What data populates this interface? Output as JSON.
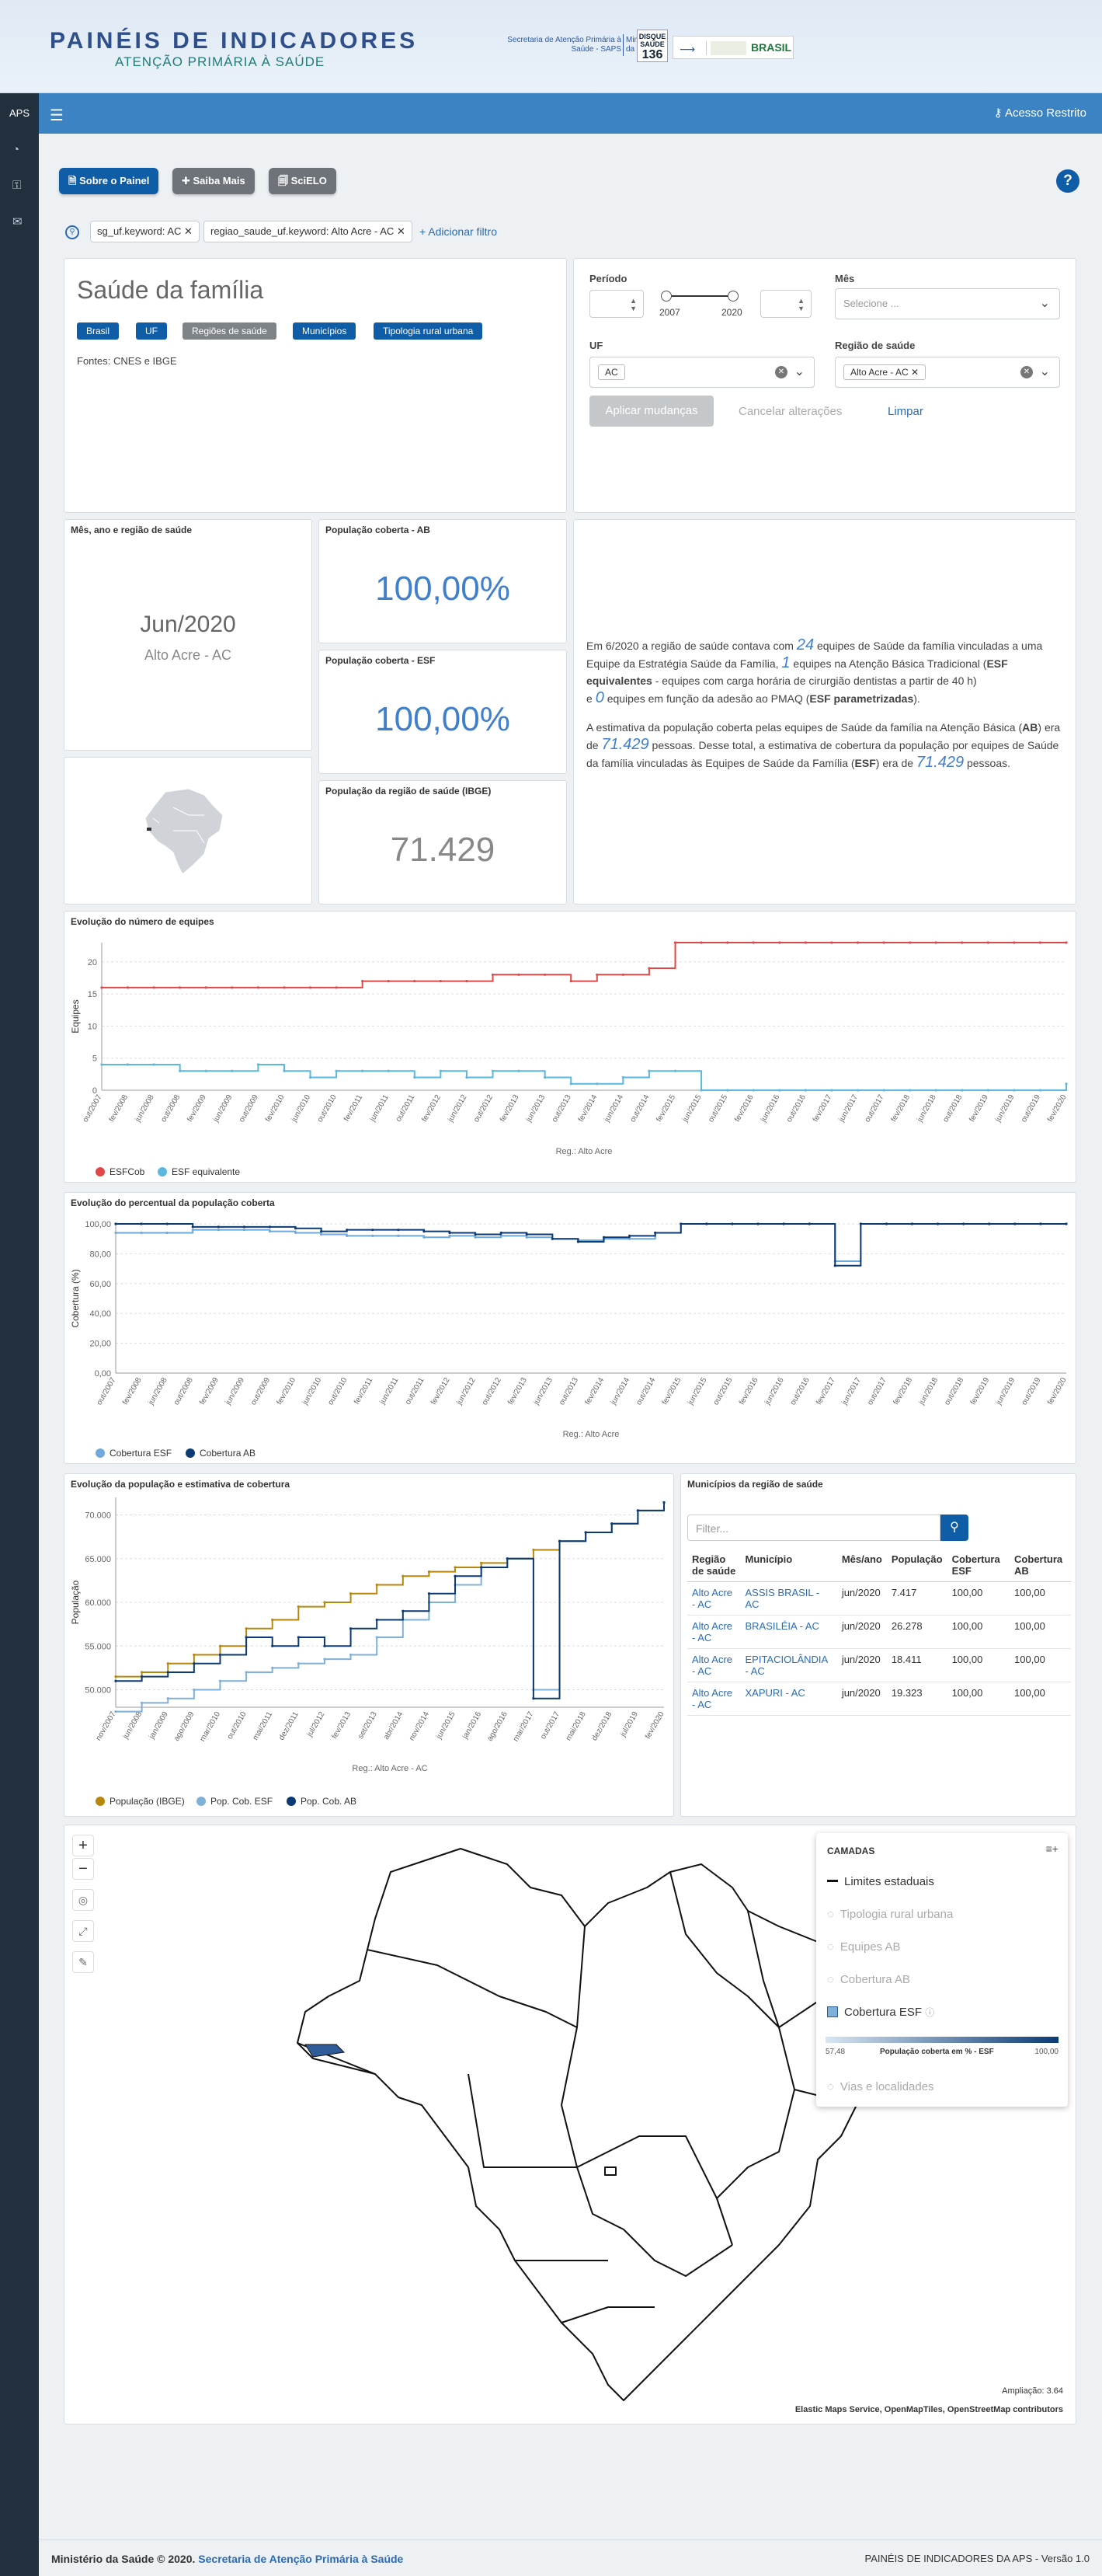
{
  "header": {
    "title": "PAINÉIS DE INDICADORES",
    "subtitle": "ATENÇÃO PRIMÁRIA À SAÚDE",
    "secretaria": "Secretaria de Atenção Primária à Saúde - SAPS",
    "ministerio": "Ministério da Saúde",
    "disque": "DISQUE SAÚDE",
    "disque_num": "136",
    "brasil": "BRASIL"
  },
  "topbar": {
    "aps": "APS",
    "login": "Acesso Restrito"
  },
  "toolbar": {
    "sobre": "Sobre o Painel",
    "saiba": "Saiba Mais",
    "scielo": "SciELO",
    "help": "?"
  },
  "filters": {
    "f1": "sg_uf.keyword: AC",
    "f2": "regiao_saude_uf.keyword: Alto Acre - AC",
    "add": "+ Adicionar filtro"
  },
  "panel": {
    "title": "Saúde da família",
    "tabs": [
      "Brasil",
      "UF",
      "Regiões de saúde",
      "Municípios",
      "Tipologia rural urbana"
    ],
    "fontes": "Fontes: CNES e IBGE"
  },
  "controls": {
    "periodo": "Período",
    "year_start": "2007",
    "year_end": "2020",
    "mes": "Mês",
    "mes_placeholder": "Selecione ...",
    "uf": "UF",
    "uf_value": "AC",
    "regiao": "Região de saúde",
    "regiao_value": "Alto Acre - AC",
    "apply": "Aplicar mudanças",
    "cancel": "Cancelar alterações",
    "clear": "Limpar"
  },
  "metrics": {
    "mes_title": "Mês, ano e região de saúde",
    "mes_value": "Jun/2020",
    "regiao_value": "Alto Acre - AC",
    "ab_title": "População coberta - AB",
    "ab_value": "100,00%",
    "esf_title": "População coberta - ESF",
    "esf_value": "100,00%",
    "pop_title": "População da região de saúde (IBGE)",
    "pop_value": "71.429"
  },
  "text": {
    "p1a": "Em 6/2020 a região de saúde contava com",
    "n1": "24",
    "p1b": "equipes de Saúde da família vinculadas a uma Equipe da Estratégia Saúde da Família,",
    "n2": "1",
    "p1c": "equipes na Atenção Básica Tradicional (",
    "esf_eq": "ESF equivalentes",
    "p1d": " - equipes com carga horária de cirurgião dentistas a partir de 40 h)",
    "p1e": "e",
    "n3": "0",
    "p1f": "equipes em função da adesão ao PMAQ (",
    "esf_par": "ESF parametrizadas",
    "p1g": ").",
    "p2a": "A estimativa da população coberta pelas equipes de Saúde da família na Atenção Básica (",
    "ab": "AB",
    "p2b": ") era de",
    "n4": "71.429",
    "p2c": "pessoas. Desse total, a estimativa de cobertura da população por equipes de Saúde da família vinculadas às Equipes de Saúde da Família (",
    "esf": "ESF",
    "p2d": ") era de",
    "n5": "71.429",
    "p2e": "pessoas."
  },
  "chart_data": [
    {
      "type": "line",
      "title": "Evolução do número de equipes",
      "xlabel": "Reg.: Alto Acre",
      "ylabel": "Equipes",
      "ylim": [
        0,
        23
      ],
      "yticks": [
        0,
        5,
        10,
        15,
        20
      ],
      "x": [
        "out/2007",
        "fev/2008",
        "jun/2008",
        "out/2008",
        "fev/2009",
        "jun/2009",
        "out/2009",
        "fev/2010",
        "jun/2010",
        "out/2010",
        "fev/2011",
        "jun/2011",
        "out/2011",
        "fev/2012",
        "jun/2012",
        "out/2012",
        "fev/2013",
        "jun/2013",
        "out/2013",
        "fev/2014",
        "jun/2014",
        "out/2014",
        "fev/2015",
        "jun/2015",
        "out/2015",
        "fev/2016",
        "jun/2016",
        "out/2016",
        "fev/2017",
        "jun/2017",
        "out/2017",
        "fev/2018",
        "jun/2018",
        "out/2018",
        "fev/2019",
        "jun/2019",
        "out/2019",
        "fev/2020"
      ],
      "series": [
        {
          "name": "ESFCob",
          "color": "#e04848",
          "values": [
            16,
            16,
            16,
            16,
            16,
            16,
            16,
            16,
            16,
            16,
            17,
            17,
            17,
            17,
            17,
            18,
            18,
            18,
            17,
            18,
            18,
            19,
            23,
            23,
            23,
            23,
            23,
            23,
            23,
            23,
            23,
            23,
            23,
            23,
            23,
            23,
            23,
            23
          ]
        },
        {
          "name": "ESF equivalente",
          "color": "#5bb8e0",
          "values": [
            4,
            4,
            4,
            3,
            3,
            3,
            4,
            3,
            2,
            3,
            3,
            3,
            2,
            3,
            2,
            3,
            3,
            2,
            1,
            1,
            2,
            3,
            3,
            0,
            0,
            0,
            0,
            0,
            0,
            0,
            0,
            0,
            0,
            0,
            0,
            0,
            0,
            1
          ]
        }
      ],
      "legend": "bottom-left",
      "grid": true
    },
    {
      "type": "line",
      "title": "Evolução do percentual da população coberta",
      "xlabel": "Reg.: Alto Acre",
      "ylabel": "Cobertura (%)",
      "ylim": [
        0,
        100
      ],
      "yticks": [
        "0,00",
        "20,00",
        "40,00",
        "60,00",
        "80,00",
        "100,00"
      ],
      "x": [
        "out/2007",
        "fev/2008",
        "jun/2008",
        "out/2008",
        "fev/2009",
        "jun/2009",
        "out/2009",
        "fev/2010",
        "jun/2010",
        "out/2010",
        "fev/2011",
        "jun/2011",
        "out/2011",
        "fev/2012",
        "jun/2012",
        "out/2012",
        "fev/2013",
        "jun/2013",
        "out/2013",
        "fev/2014",
        "jun/2014",
        "out/2014",
        "fev/2015",
        "jun/2015",
        "out/2015",
        "fev/2016",
        "jun/2016",
        "out/2016",
        "fev/2017",
        "jun/2017",
        "out/2017",
        "fev/2018",
        "jun/2018",
        "out/2018",
        "fev/2019",
        "jun/2019",
        "out/2019",
        "fev/2020"
      ],
      "series": [
        {
          "name": "Cobertura ESF",
          "color": "#6fa8dc",
          "values": [
            94,
            94,
            94,
            96,
            96,
            96,
            95,
            94,
            93,
            92,
            92,
            92,
            91,
            92,
            91,
            92,
            91,
            90,
            89,
            90,
            90,
            94,
            100,
            100,
            100,
            100,
            100,
            100,
            75,
            100,
            100,
            100,
            100,
            100,
            100,
            100,
            100,
            100
          ]
        },
        {
          "name": "Cobertura AB",
          "color": "#0b3a75",
          "values": [
            100,
            100,
            100,
            98,
            98,
            98,
            98,
            97,
            95,
            96,
            96,
            96,
            95,
            94,
            93,
            94,
            93,
            90,
            88,
            91,
            92,
            94,
            100,
            100,
            100,
            100,
            100,
            100,
            72,
            100,
            100,
            100,
            100,
            100,
            100,
            100,
            100,
            100
          ]
        }
      ],
      "legend": "bottom-left",
      "grid": true
    },
    {
      "type": "line",
      "title": "Evolução da população e estimativa de cobertura",
      "xlabel": "Reg.: Alto Acre - AC",
      "ylabel": "População",
      "ylim": [
        48000,
        72000
      ],
      "yticks": [
        "50.000",
        "55.000",
        "60.000",
        "65.000",
        "70.000"
      ],
      "x": [
        "nov/2007",
        "jun/2008",
        "jan/2009",
        "ago/2009",
        "mar/2010",
        "out/2010",
        "mai/2011",
        "dez/2011",
        "jul/2012",
        "fev/2013",
        "set/2013",
        "abr/2014",
        "nov/2014",
        "jun/2015",
        "jan/2016",
        "ago/2016",
        "mar/2017",
        "out/2017",
        "mai/2018",
        "dez/2018",
        "jul/2019",
        "fev/2020"
      ],
      "series": [
        {
          "name": "População (IBGE)",
          "color": "#b8860b",
          "values": [
            51500,
            52000,
            53000,
            54000,
            55000,
            57000,
            58000,
            59500,
            60000,
            61000,
            62000,
            63000,
            63500,
            64000,
            64500,
            65000,
            66000,
            67000,
            68000,
            69000,
            70500,
            71429
          ]
        },
        {
          "name": "Pop. Cob. ESF",
          "color": "#7fb0d8",
          "values": [
            47500,
            48500,
            49000,
            50000,
            51000,
            52000,
            52500,
            53000,
            53500,
            54000,
            56000,
            58000,
            60000,
            62000,
            64000,
            65000,
            50000,
            67000,
            68000,
            69000,
            70500,
            71429
          ]
        },
        {
          "name": "Pop. Cob. AB",
          "color": "#0b3a75",
          "values": [
            51000,
            51500,
            52000,
            53000,
            54000,
            56000,
            55000,
            56000,
            55000,
            57000,
            58000,
            59000,
            61000,
            63000,
            64000,
            65000,
            49000,
            67000,
            68000,
            69000,
            70500,
            71429
          ]
        }
      ],
      "legend": "bottom-left",
      "grid": true
    }
  ],
  "municipios": {
    "title": "Municípios da região de saúde",
    "filter_placeholder": "Filter...",
    "headers": [
      "Região de saúde",
      "Município",
      "Mês/ano",
      "População",
      "Cobertura ESF",
      "Cobertura AB"
    ],
    "rows": [
      [
        "Alto Acre - AC",
        "ASSIS BRASIL - AC",
        "jun/2020",
        "7.417",
        "100,00",
        "100,00"
      ],
      [
        "Alto Acre - AC",
        "BRASILÉIA - AC",
        "jun/2020",
        "26.278",
        "100,00",
        "100,00"
      ],
      [
        "Alto Acre - AC",
        "EPITACIOLÂNDIA - AC",
        "jun/2020",
        "18.411",
        "100,00",
        "100,00"
      ],
      [
        "Alto Acre - AC",
        "XAPURI - AC",
        "jun/2020",
        "19.323",
        "100,00",
        "100,00"
      ]
    ]
  },
  "map": {
    "layers_title": "CAMADAS",
    "layers": [
      "Limites estaduais",
      "Tipologia rural urbana",
      "Equipes AB",
      "Cobertura AB",
      "Cobertura ESF",
      "Vias e localidades"
    ],
    "scale_min": "57,48",
    "scale_label": "População coberta em % - ESF",
    "scale_max": "100,00",
    "zoom": "Ampliação: 3.64",
    "attribution": "Elastic Maps Service, OpenMapTiles, OpenStreetMap contributors"
  },
  "footer": {
    "left": "Ministério da Saúde © 2020.",
    "link": "Secretaria de Atenção Primária à Saúde",
    "right": "PAINÉIS DE INDICADORES DA APS - Versão 1.0"
  },
  "colors": {
    "primary": "#0f5da6",
    "topbar": "#3b83c2",
    "sidebar": "#22303d",
    "accent": "#3f7fcb"
  }
}
